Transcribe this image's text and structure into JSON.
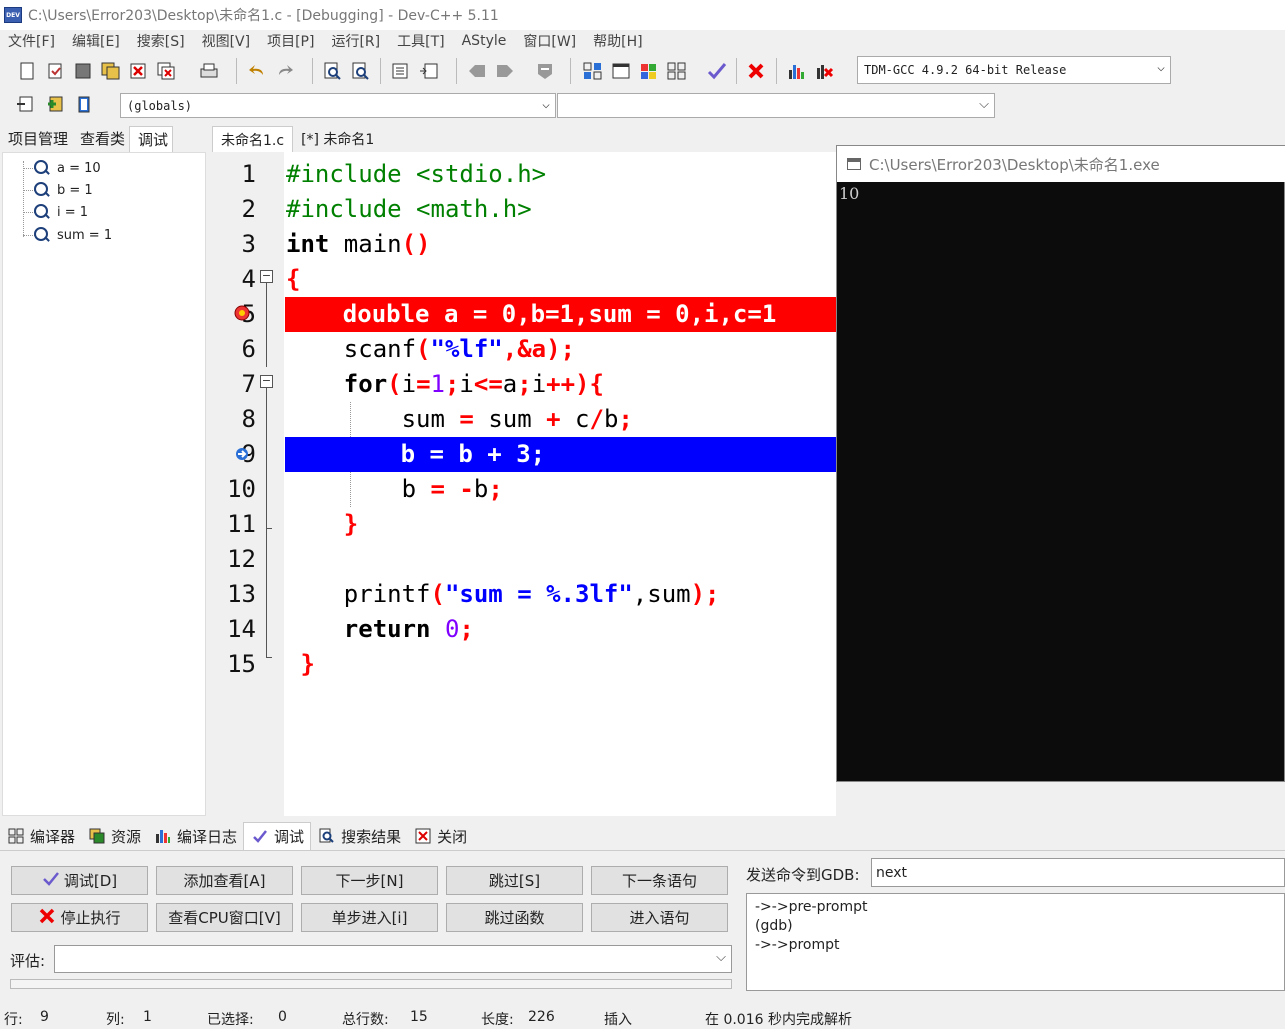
{
  "window": {
    "title": "C:\\Users\\Error203\\Desktop\\未命名1.c - [Debugging] - Dev-C++ 5.11",
    "app_icon": "DEV"
  },
  "menu": [
    "文件[F]",
    "编辑[E]",
    "搜索[S]",
    "视图[V]",
    "项目[P]",
    "运行[R]",
    "工具[T]",
    "AStyle",
    "窗口[W]",
    "帮助[H]"
  ],
  "toolbar": {
    "compiler": "TDM-GCC 4.9.2 64-bit Release",
    "scope": "(globals)",
    "function": ""
  },
  "left_tabs": [
    "项目管理",
    "查看类",
    "调试"
  ],
  "watches": [
    "a = 10",
    "b = 1",
    "i = 1",
    "sum = 1"
  ],
  "editor_tabs": [
    "未命名1.c",
    "[*] 未命名1"
  ],
  "code": {
    "line_numbers": [
      "1",
      "2",
      "3",
      "4",
      "5",
      "6",
      "7",
      "8",
      "9",
      "10",
      "11",
      "12",
      "13",
      "14",
      "15"
    ],
    "l1": "#include <stdio.h>",
    "l2": "#include <math.h>",
    "l3_kw": "int",
    "l3_rest": " main",
    "l3_paren": "()",
    "l4": "{",
    "l5_kw": "double",
    "l5_rest": " a = 0,b=1,sum = 0,i,c=1",
    "l6_fn": "scanf",
    "l6_p1": "(",
    "l6_str": "\"%lf\"",
    "l6_rest": ",&a);",
    "l7_kw": "for",
    "l7_p1": "(",
    "l7_i": "i",
    "l7_eq": "=",
    "l7_one": "1",
    "l7_semi": ";",
    "l7_i2": "i",
    "l7_le": "<=",
    "l7_a": "a",
    "l7_semi2": ";",
    "l7_i3": "i",
    "l7_pp": "++){",
    "l8_sum": "sum",
    "l8_eq": " = ",
    "l8_sum2": "sum",
    "l8_plus": " + ",
    "l8_c": "c",
    "l8_div": "/",
    "l8_b": "b",
    "l8_semi": ";",
    "l9": "b = b + 3;",
    "l10_b": "b",
    "l10_eq": " = ",
    "l10_neg": "-",
    "l10_b2": "b",
    "l10_semi": ";",
    "l11": "}",
    "l13_fn": "printf",
    "l13_p": "(",
    "l13_str": "\"sum = %.3lf\"",
    "l13_rest": ",sum",
    "l13_end": ");",
    "l14_kw": "return",
    "l14_num": "0",
    "l14_semi": ";",
    "l15": "}"
  },
  "console": {
    "title": "C:\\Users\\Error203\\Desktop\\未命名1.exe",
    "output": "10"
  },
  "bottom_tabs": [
    {
      "label": "编译器",
      "icon": "grid-icon"
    },
    {
      "label": "资源",
      "icon": "resources-icon"
    },
    {
      "label": "编译日志",
      "icon": "bar-chart-icon"
    },
    {
      "label": "调试",
      "icon": "check-icon"
    },
    {
      "label": "搜索结果",
      "icon": "search-icon"
    },
    {
      "label": "关闭",
      "icon": "close-icon"
    }
  ],
  "debug_buttons": {
    "debug": "调试[D]",
    "add_watch": "添加查看[A]",
    "next_step": "下一步[N]",
    "skip": "跳过[S]",
    "next_statement": "下一条语句",
    "stop": "停止执行",
    "cpu_window": "查看CPU窗口[V]",
    "step_into": "单步进入[i]",
    "skip_function": "跳过函数",
    "into_statement": "进入语句"
  },
  "eval": {
    "label": "评估:",
    "value": ""
  },
  "gdb": {
    "label": "发送命令到GDB:",
    "command": "next",
    "output": [
      "->->pre-prompt",
      "(gdb)",
      "->->prompt"
    ]
  },
  "status": {
    "row_label": "行:",
    "row": "9",
    "col_label": "列:",
    "col": "1",
    "sel_label": "已选择:",
    "sel": "0",
    "lines_label": "总行数:",
    "lines": "15",
    "len_label": "长度:",
    "len": "226",
    "mode": "插入",
    "parse": "在 0.016 秒内完成解析"
  }
}
